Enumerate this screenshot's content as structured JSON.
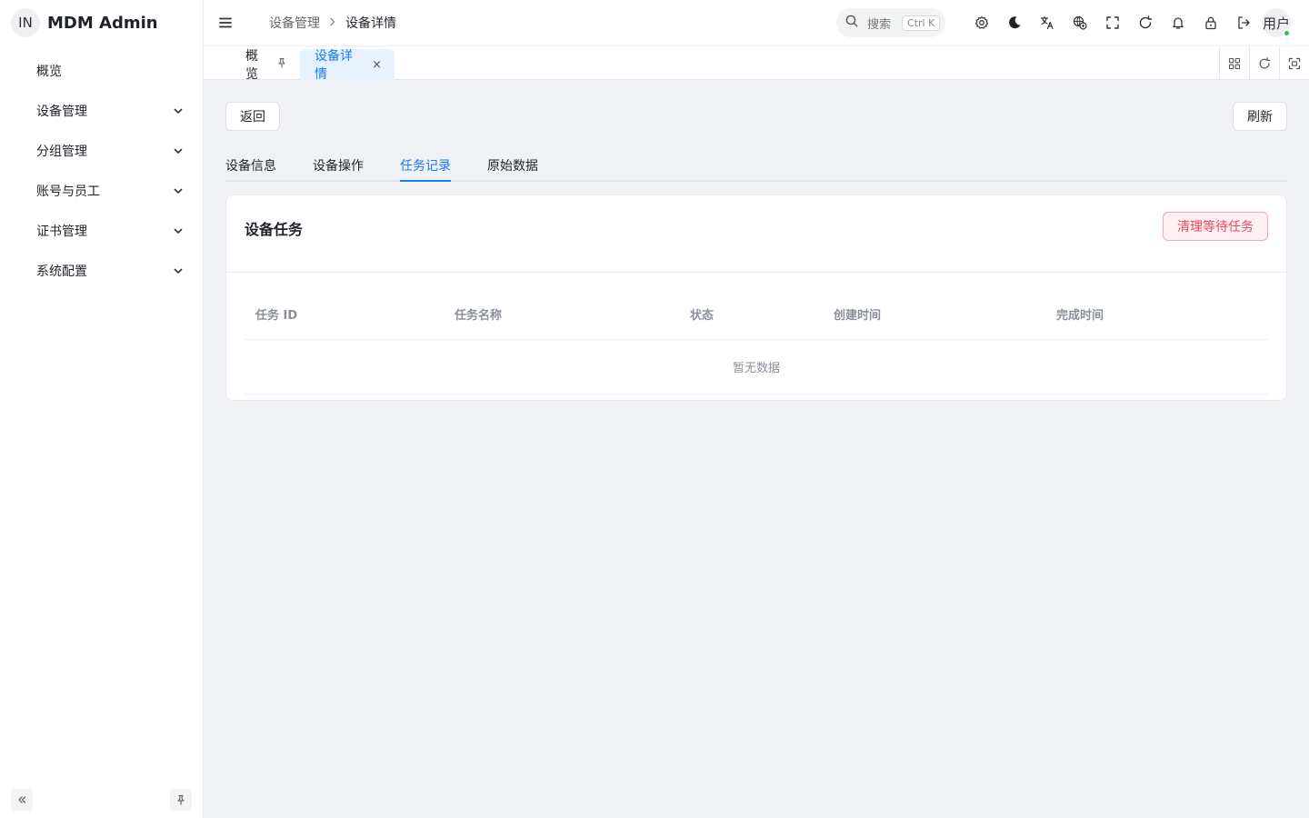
{
  "brand": {
    "logo": "IN",
    "title": "MDM Admin"
  },
  "sidebar": {
    "items": [
      {
        "label": "概览",
        "has_children": false
      },
      {
        "label": "设备管理",
        "has_children": true
      },
      {
        "label": "分组管理",
        "has_children": true
      },
      {
        "label": "账号与员工",
        "has_children": true
      },
      {
        "label": "证书管理",
        "has_children": true
      },
      {
        "label": "系统配置",
        "has_children": true
      }
    ],
    "footer_icons": [
      "collapse-double-left-icon",
      "pin-icon"
    ]
  },
  "header": {
    "breadcrumb": [
      "设备管理",
      "设备详情"
    ],
    "search": {
      "label": "搜索",
      "shortcut": "Ctrl K"
    },
    "icons": [
      "settings-icon",
      "moon-icon",
      "translate-icon",
      "globe-icon",
      "fullscreen-icon",
      "refresh-icon",
      "bell-icon",
      "lock-icon",
      "logout-icon"
    ],
    "user": "用户"
  },
  "tabs": [
    {
      "label": "概览",
      "pinned": true,
      "active": false
    },
    {
      "label": "设备详情",
      "closable": true,
      "active": true,
      "close": "×"
    }
  ],
  "tab_tools": [
    "grid-icon",
    "refresh-icon",
    "fullscreen-icon"
  ],
  "colors": {
    "accent": "#1677ff",
    "danger": "#e8475f",
    "online": "#22c55e"
  },
  "page": {
    "back_button": "返回",
    "refresh_button": "刷新",
    "subtabs": [
      {
        "label": "设备信息",
        "active": false
      },
      {
        "label": "设备操作",
        "active": false
      },
      {
        "label": "任务记录",
        "active": true
      },
      {
        "label": "原始数据",
        "active": false
      }
    ],
    "card": {
      "title": "设备任务",
      "clear_button": "清理等待任务",
      "columns": [
        "任务 ID",
        "任务名称",
        "状态",
        "创建时间",
        "完成时间"
      ],
      "empty_text": "暂无数据"
    }
  }
}
